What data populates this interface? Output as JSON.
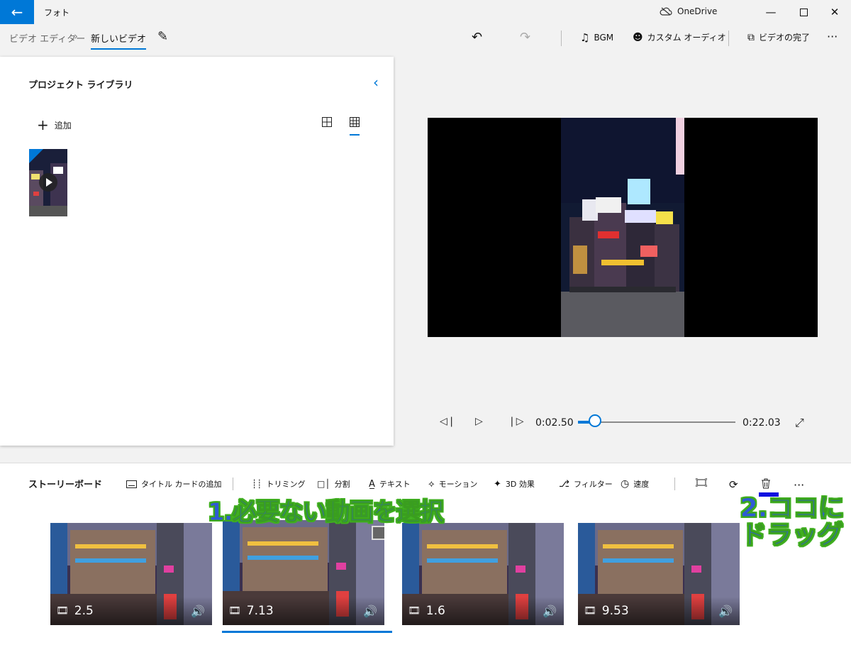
{
  "window": {
    "app_title": "フォト",
    "onedrive_label": "OneDrive"
  },
  "breadcrumb": {
    "root": "ビデオ エディター",
    "current": "新しいビデオ"
  },
  "toolbar": {
    "bgm_label": "BGM",
    "custom_audio_label": "カスタム オーディオ",
    "finish_label": "ビデオの完了",
    "more_label": "···"
  },
  "library": {
    "title": "プロジェクト ライブラリ",
    "add_label": "追加"
  },
  "playback": {
    "current_time": "0:02.50",
    "total_time": "0:22.03",
    "progress": 0.11
  },
  "storyboard": {
    "title": "ストーリーボード",
    "commands": {
      "title_card": "タイトル カードの追加",
      "trim": "トリミング",
      "split": "分割",
      "text": "テキスト",
      "motion": "モーション",
      "effects_3d": "3D 効果",
      "filters": "フィルター",
      "speed": "速度",
      "more": "···"
    },
    "clips": [
      {
        "duration": "2.5",
        "selected": false
      },
      {
        "duration": "7.13",
        "selected": true
      },
      {
        "duration": "1.6",
        "selected": false
      },
      {
        "duration": "9.53",
        "selected": false
      }
    ]
  },
  "annotations": {
    "step1": "1.必要ない動画を選択",
    "step2_line1": "2.ココに",
    "step2_line2": "ドラッグ"
  },
  "colors": {
    "accent": "#0078d7",
    "annotation_text": "#2f5bd6",
    "annotation_outline": "#40b020"
  }
}
